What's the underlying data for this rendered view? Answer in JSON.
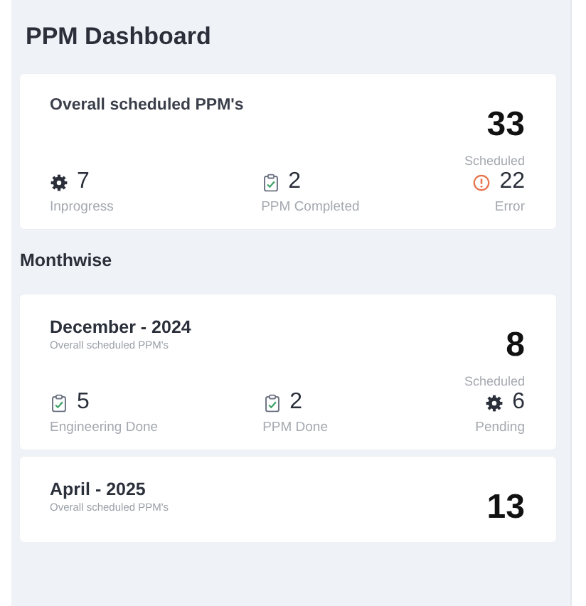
{
  "title": "PPM Dashboard",
  "overall": {
    "title": "Overall scheduled PPM's",
    "total": "33",
    "total_label": "Scheduled",
    "stats": [
      {
        "kind": "gear",
        "value": "7",
        "label": "Inprogress"
      },
      {
        "kind": "clipboard",
        "value": "2",
        "label": "PPM Completed"
      },
      {
        "kind": "alert",
        "value": "22",
        "label": "Error"
      }
    ]
  },
  "monthwise": {
    "heading": "Monthwise",
    "months": [
      {
        "title": "December - 2024",
        "subtitle": "Overall scheduled PPM's",
        "total": "8",
        "total_label": "Scheduled",
        "stats": [
          {
            "kind": "clipboard",
            "value": "5",
            "label": "Engineering Done"
          },
          {
            "kind": "clipboard",
            "value": "2",
            "label": "PPM Done"
          },
          {
            "kind": "gear",
            "value": "6",
            "label": "Pending"
          }
        ]
      },
      {
        "title": "April - 2025",
        "subtitle": "Overall scheduled PPM's",
        "total": "13"
      }
    ]
  }
}
